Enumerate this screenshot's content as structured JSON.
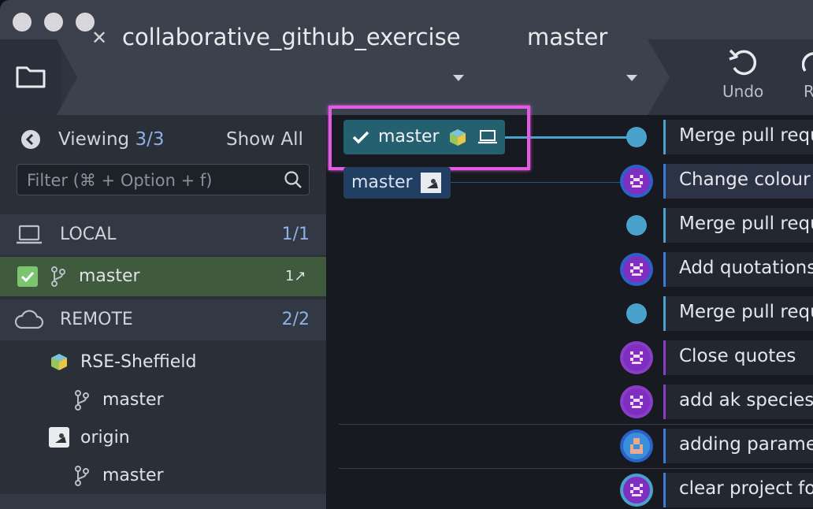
{
  "toolbar": {
    "repo_name": "collaborative_github_exercise",
    "branch_name": "master",
    "undo_label": "Undo",
    "redo_label": "R",
    "icons": [
      "folder-icon",
      "close-icon",
      "chevron-down-icon",
      "undo-icon"
    ]
  },
  "sidebar": {
    "viewing_label": "Viewing",
    "viewing_count": "3/3",
    "show_all": "Show All",
    "filter_placeholder": "Filter (⌘ + Option + f)",
    "local": {
      "label": "LOCAL",
      "count": "1/1"
    },
    "local_branch": {
      "name": "master",
      "status": "1↗"
    },
    "remote": {
      "label": "REMOTE",
      "count": "2/2"
    },
    "remotes": [
      {
        "name": "RSE-Sheffield",
        "branch": "master"
      },
      {
        "name": "origin",
        "branch": "master"
      }
    ]
  },
  "graph": {
    "branch_badges": [
      {
        "label": "master",
        "icons": [
          "remote-avatar-icon",
          "laptop-icon"
        ]
      },
      {
        "label": "master",
        "icons": [
          "origin-avatar-icon"
        ]
      }
    ],
    "commits": [
      {
        "message": "Merge pull requ",
        "marker": "dot"
      },
      {
        "message": "Change colour",
        "marker": "avatar"
      },
      {
        "message": "Merge pull requ",
        "marker": "dot"
      },
      {
        "message": "Add quotations",
        "marker": "avatar"
      },
      {
        "message": "Merge pull requ",
        "marker": "dot"
      },
      {
        "message": "Close quotes",
        "marker": "avatar"
      },
      {
        "message": "add ak species",
        "marker": "avatar"
      },
      {
        "message": "adding parame",
        "marker": "avatar"
      },
      {
        "message": "clear project fo",
        "marker": "avatar"
      }
    ]
  },
  "colors": {
    "accent_blue": "#4aa2cc",
    "local_selected": "#3f5a3c",
    "highlight": "#e35ae3",
    "purple": "#8a3ec8"
  }
}
